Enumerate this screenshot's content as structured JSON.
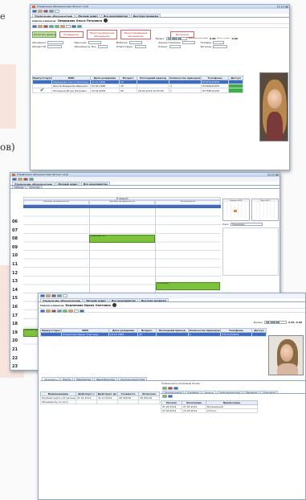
{
  "background": {
    "fragment_top": "e",
    "fragment_mid": "ов)"
  },
  "w1": {
    "title": "Управление абонементами  Фитнес клуб",
    "tabs": [
      "Управление абонементами",
      "Личный аудит",
      "Все мероприятия",
      "Быстрая продажа"
    ],
    "client_list_label": "Список клиентов",
    "client_name": "Свиридова Ольга  Петровна",
    "btn_pay": "Оплатить фильтр",
    "btn_new": "Незаверенн.",
    "btn_freeze": "Приостановленные абонементы",
    "btn_renew": "Нескопированные абонементы",
    "btn_debt": "Должники",
    "balance_label": "Баланс",
    "balance_value": "33 600.00",
    "bonus_label": "Карточных для скидок",
    "bonus_value": "0.00",
    "debt_label": "Итого к оплате",
    "debt_value": "0.00",
    "filters": [
      "Абонемент",
      "Персонал",
      "Мобилен",
      "Зарегистрирован",
      "Телефон",
      "Регионы",
      "Абонент №",
      "Абонементы: Все",
      "Ответственн.",
      "Клиент"
    ],
    "columns": [
      "Присутствует",
      "ФИО",
      "Дата рождения",
      "Возраст",
      "Последний приход",
      "Количество приходов",
      "Телефоны",
      "Доступ"
    ],
    "rows": [
      {
        "fio": "Свиридова Ольга Петровна",
        "dob": "11.11.1990",
        "age": "23",
        "last": "",
        "count": "",
        "phone": "87075123456"
      },
      {
        "fio": "Шилов Владимир Иванович",
        "dob": "02.02.1988",
        "age": "25",
        "last": "",
        "count": "2",
        "phone": "87059643209"
      },
      {
        "fio": "Фтоменов Игорь Петрович",
        "dob": "02.01.2008",
        "age": "06",
        "last": "18.02.2014 19:45:00",
        "count": "1",
        "phone": "87758412190"
      }
    ]
  },
  "w2": {
    "title": "Управление абонементами  Фитнес клуб",
    "tabs": [
      "Управление абонементами",
      "Личный аудит",
      "Все мероприятия"
    ],
    "subtabs": [
      "Таблица",
      "Календарь"
    ],
    "date_header": "15 февраля",
    "halls": [
      "Групповая тренировочная зал",
      "Групповая тренировочная зал",
      "Тренажерный зал"
    ],
    "hours": [
      "06",
      "07",
      "08",
      "09",
      "10",
      "11",
      "12",
      "13",
      "14",
      "15",
      "16",
      "17",
      "18",
      "19",
      "20",
      "21",
      "22",
      "23"
    ],
    "events": [
      "Групповые программы",
      "Бодибилдинг (Вт)",
      "Гр. программ",
      "Аквааэробика"
    ],
    "minical_title": "Февраль 2014",
    "minical_title2": "Март 2014",
    "filter_label": "Поиск",
    "filter_value": "Тренировки"
  },
  "w3": {
    "tabs": [
      "Управление абонементами",
      "Личный аудит",
      "Все мероприятия",
      "Быстрая продажа"
    ],
    "client_list_label": "Список клиентов",
    "client_name": "Корнилова Ирина  Олеговна",
    "balance_label": "Баланс",
    "balance_value": "26 400.00",
    "bonus_value": "0.00",
    "debt_value": "0.00",
    "columns": [
      "Присутствует",
      "ФИО",
      "Дата рождения",
      "Возраст",
      "Последний приход",
      "Количество приходов",
      "Телефоны",
      "Доступ"
    ],
    "row": {
      "fio": "Корнилова Ирина Олеговна",
      "dob": "18.01.1989",
      "age": "25",
      "count": "2",
      "phone": "87071234679"
    },
    "bottom_tabs": [
      "Абонементы",
      "Визиты",
      "Мероприятия",
      "Идентификаторы",
      "Контроль присутствия"
    ],
    "sub_columns": [
      "Наименование",
      "Действует с",
      "Действует до",
      "Стоимость",
      "Оплачено"
    ],
    "sub_row": {
      "name": "Клубная карта (12 месяцев)",
      "from": "01.01.2014",
      "to": "31.12.2014",
      "cost": "26 400.00",
      "paid": "26 400.00"
    },
    "sub_row2": {
      "name": "Абонементы по лету",
      "from": "",
      "to": "",
      "cost": "",
      "paid": ""
    },
    "right_header": "Клубная карта (12 месяцев) Полная",
    "right_tabs": [
      "Доступные разделы",
      "Услуги/время",
      "Заморозки",
      "Список дополнительных",
      "Мероприятия",
      "Состав группы"
    ],
    "right_columns": [
      "Начало",
      "Окончание",
      "Примечание"
    ],
    "right_rows": [
      {
        "start": "21.02.2014",
        "end": "27.02.2014",
        "note": "Больничный"
      },
      {
        "start": "07.03.2014",
        "end": "15.03.2014",
        "note": "Отпуск"
      }
    ]
  }
}
